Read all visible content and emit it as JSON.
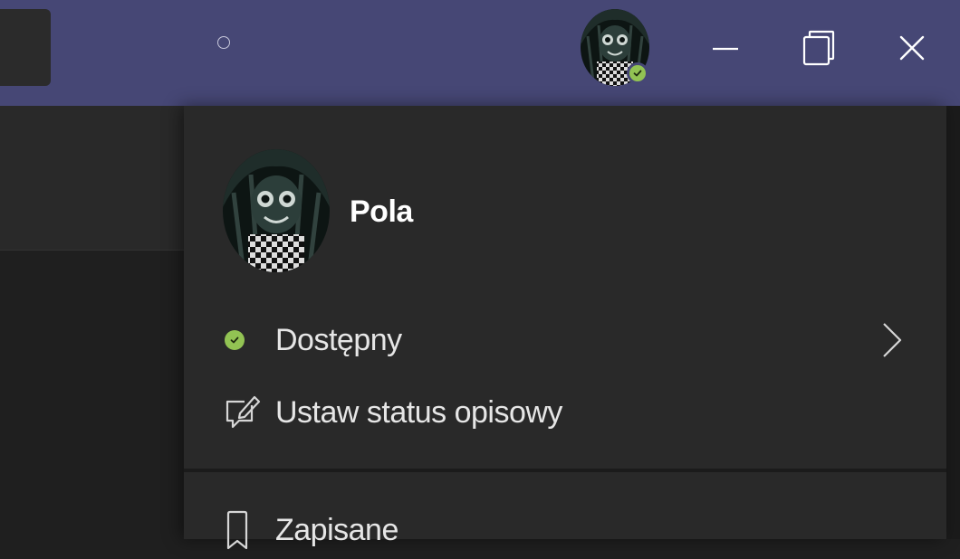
{
  "titlebar": {
    "accent_color": "#464775",
    "avatar": {
      "icon": "user-avatar",
      "presence": "available",
      "presence_color": "#92c353"
    },
    "window_controls": [
      {
        "name": "minimize",
        "icon": "minimize-icon"
      },
      {
        "name": "restore",
        "icon": "restore-icon"
      },
      {
        "name": "close",
        "icon": "close-icon"
      }
    ]
  },
  "profile_menu": {
    "user_name": "Pola",
    "avatar_icon": "user-avatar",
    "items": [
      {
        "label": "Dostępny",
        "icon": "presence-available-icon",
        "color": "#92c353",
        "has_submenu": true
      },
      {
        "label": "Ustaw status opisowy",
        "icon": "edit-status-icon"
      },
      {
        "label": "Zapisane",
        "icon": "bookmark-icon"
      }
    ]
  }
}
